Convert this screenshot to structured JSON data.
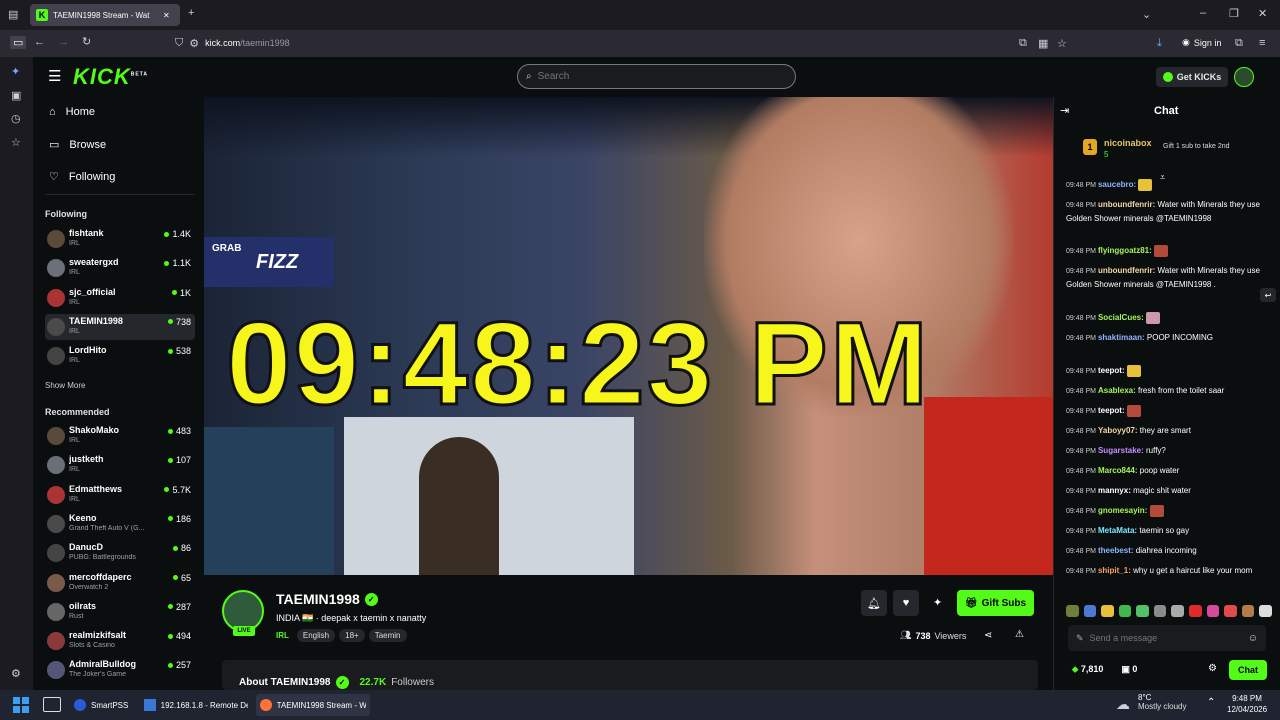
{
  "browser": {
    "tab_title": "TAEMIN1998 Stream - Wat",
    "url_domain": "kick.com",
    "url_path": "/taemin1998",
    "signin_label": "Sign in"
  },
  "header": {
    "logo": "KICK",
    "logo_badge": "BETA",
    "search_placeholder": "Search",
    "get_kicks_label": "Get KICKs"
  },
  "nav": [
    {
      "label": "Home",
      "icon": "home-icon"
    },
    {
      "label": "Browse",
      "icon": "browse-icon"
    },
    {
      "label": "Following",
      "icon": "heart-icon"
    }
  ],
  "following": {
    "heading": "Following",
    "show_more": "Show More",
    "channels": [
      {
        "name": "fishtank",
        "category": "IRL",
        "viewers": "1.4K"
      },
      {
        "name": "sweatergxd",
        "category": "IRL",
        "viewers": "1.1K"
      },
      {
        "name": "sjc_official",
        "category": "IRL",
        "viewers": "1K"
      },
      {
        "name": "TAEMIN1998",
        "category": "IRL",
        "viewers": "738"
      },
      {
        "name": "LordHito",
        "category": "IRL",
        "viewers": "538"
      }
    ]
  },
  "recommended": {
    "heading": "Recommended",
    "channels": [
      {
        "name": "ShakoMako",
        "category": "IRL",
        "viewers": "483"
      },
      {
        "name": "justketh",
        "category": "IRL",
        "viewers": "107"
      },
      {
        "name": "Edmatthews",
        "category": "IRL",
        "viewers": "5.7K"
      },
      {
        "name": "Keeno",
        "category": "Grand Theft Auto V (G...",
        "viewers": "186"
      },
      {
        "name": "DanucD",
        "category": "PUBG: Battlegrounds",
        "viewers": "86"
      },
      {
        "name": "mercoffdaperc",
        "category": "Overwatch 2",
        "viewers": "65"
      },
      {
        "name": "oilrats",
        "category": "Rust",
        "viewers": "287"
      },
      {
        "name": "realmizkifsalt",
        "category": "Slots & Casino",
        "viewers": "494"
      },
      {
        "name": "AdmiralBulldog",
        "category": "The Joker's Game",
        "viewers": "257"
      }
    ]
  },
  "video": {
    "overlay_clock": "09:48:23 PM",
    "sign_text_1": "GRAB",
    "sign_text_2": "FIZZ"
  },
  "stream": {
    "name": "TAEMIN1998",
    "live_badge": "LIVE",
    "title": "INDIA 🇮🇳 · deepak x taemin x nanatty",
    "category": "IRL",
    "tags": [
      "English",
      "18+",
      "Taemin"
    ],
    "gift_subs_label": "Gift Subs",
    "viewer_count": "738",
    "viewer_label": "Viewers",
    "about_label": "About TAEMIN1998",
    "followers": "22.7K",
    "followers_label": "Followers"
  },
  "chat": {
    "title": "Chat",
    "pinned_user": "nicoinabox",
    "pinned_rank": "1",
    "pinned_count": "5",
    "pinned_cta": "Gift 1 sub to take 2nd",
    "messages": [
      {
        "time": "09:48 PM",
        "user": "saucebro:",
        "text": "",
        "color": "#8fb4ff"
      },
      {
        "time": "09:48 PM",
        "user": "unboundfenrir:",
        "text": "Water with Minerals they use Golden Shower minerals @TAEMIN1998",
        "color": "#f5d6a6"
      },
      {
        "time": "09:48 PM",
        "user": "flyinggoatz81:",
        "text": "",
        "color": "#a6f25c"
      },
      {
        "time": "09:48 PM",
        "user": "unboundfenrir:",
        "text": "Water with Minerals they use Golden Shower minerals @TAEMIN1998 .",
        "color": "#f5d6a6"
      },
      {
        "time": "09:48 PM",
        "user": "SocialCues:",
        "text": "",
        "color": "#a6f25c"
      },
      {
        "time": "09:48 PM",
        "user": "shaktimaan:",
        "text": "POOP INCOMING",
        "color": "#8fb4ff"
      },
      {
        "time": "09:48 PM",
        "user": "teepot:",
        "text": "",
        "color": "#ffffff"
      },
      {
        "time": "09:48 PM",
        "user": "Asablexa:",
        "text": "fresh from the toilet saar",
        "color": "#a6f25c"
      },
      {
        "time": "09:48 PM",
        "user": "teepot:",
        "text": "",
        "color": "#ffffff"
      },
      {
        "time": "09:48 PM",
        "user": "Yaboyy07:",
        "text": "they are smart",
        "color": "#f5d6a6"
      },
      {
        "time": "09:48 PM",
        "user": "Sugarstake:",
        "text": "ruffy?",
        "color": "#c58fff"
      },
      {
        "time": "09:48 PM",
        "user": "Marco844:",
        "text": "poop water",
        "color": "#a6f25c"
      },
      {
        "time": "09:48 PM",
        "user": "mannyx:",
        "text": "magic shit water",
        "color": "#ffffff"
      },
      {
        "time": "09:48 PM",
        "user": "gnomesayin:",
        "text": "",
        "color": "#a6f25c"
      },
      {
        "time": "09:48 PM",
        "user": "MetaMata:",
        "text": "taemin so gay",
        "color": "#7fe7ff"
      },
      {
        "time": "09:48 PM",
        "user": "theebest:",
        "text": "diahrea incoming",
        "color": "#8fb4ff"
      },
      {
        "time": "09:48 PM",
        "user": "shipit_1:",
        "text": "why u get a haircut like your mom",
        "color": "#ff9f6b"
      }
    ],
    "input_placeholder": "Send a message",
    "points": "7,810",
    "other_count": "0",
    "chat_button": "Chat"
  },
  "taskbar": {
    "apps": [
      {
        "label": "SmartPSS"
      },
      {
        "label": "192.168.1.8 - Remote De"
      },
      {
        "label": "TAEMIN1998 Stream - W"
      }
    ],
    "weather_temp": "8°C",
    "weather_desc": "Mostly cloudy",
    "time": "9:48 PM",
    "date": "12/04/2026"
  }
}
